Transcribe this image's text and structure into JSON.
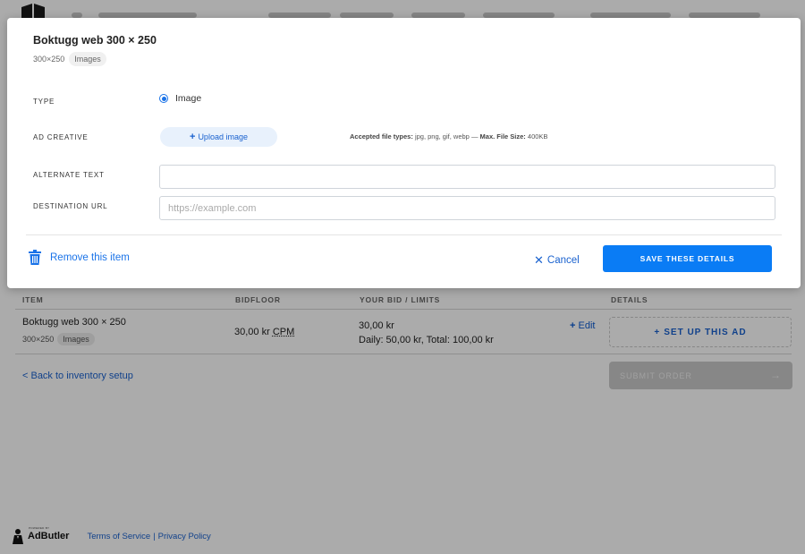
{
  "modal": {
    "title": "Boktugg web 300 × 250",
    "size": "300×250",
    "format_badge": "Images",
    "type_label": "TYPE",
    "type_option": "Image",
    "ad_creative_label": "AD CREATIVE",
    "upload_button": "Upload image",
    "file_types_label": "Accepted file types:",
    "file_types": "jpg, png, gif, webp",
    "file_sep": "—",
    "max_size_label": "Max. File Size:",
    "max_size": "400KB",
    "alt_text_label": "ALTERNATE TEXT",
    "alt_text_value": "",
    "destination_url_label": "DESTINATION URL",
    "destination_url_placeholder": "https://example.com",
    "remove_item": "Remove this item",
    "cancel": "Cancel",
    "save": "SAVE THESE DETAILS"
  },
  "table": {
    "headers": [
      "ITEM",
      "BIDFLOOR",
      "YOUR BID / LIMITS",
      "DETAILS"
    ],
    "row": {
      "name": "Boktugg web 300 × 250",
      "size": "300×250",
      "format": "Images",
      "bidfloor": "30,00 kr",
      "bidfloor_unit": "CPM",
      "bid": "30,00 kr",
      "limits": "Daily: 50,00 kr, Total: 100,00 kr",
      "edit": "Edit",
      "setup": "SET UP THIS AD"
    }
  },
  "back_link": "< Back to inventory setup",
  "submit": "SUBMIT ORDER",
  "footer": {
    "brand": "AdButler",
    "brand_tagline": "POWERED BY",
    "terms": "Terms of Service",
    "separator": "|",
    "privacy": "Privacy Policy"
  },
  "colors": {
    "primary": "#0a7cf5",
    "link": "#1a62cf",
    "overlay": "rgba(0,0,0,0.33)"
  }
}
